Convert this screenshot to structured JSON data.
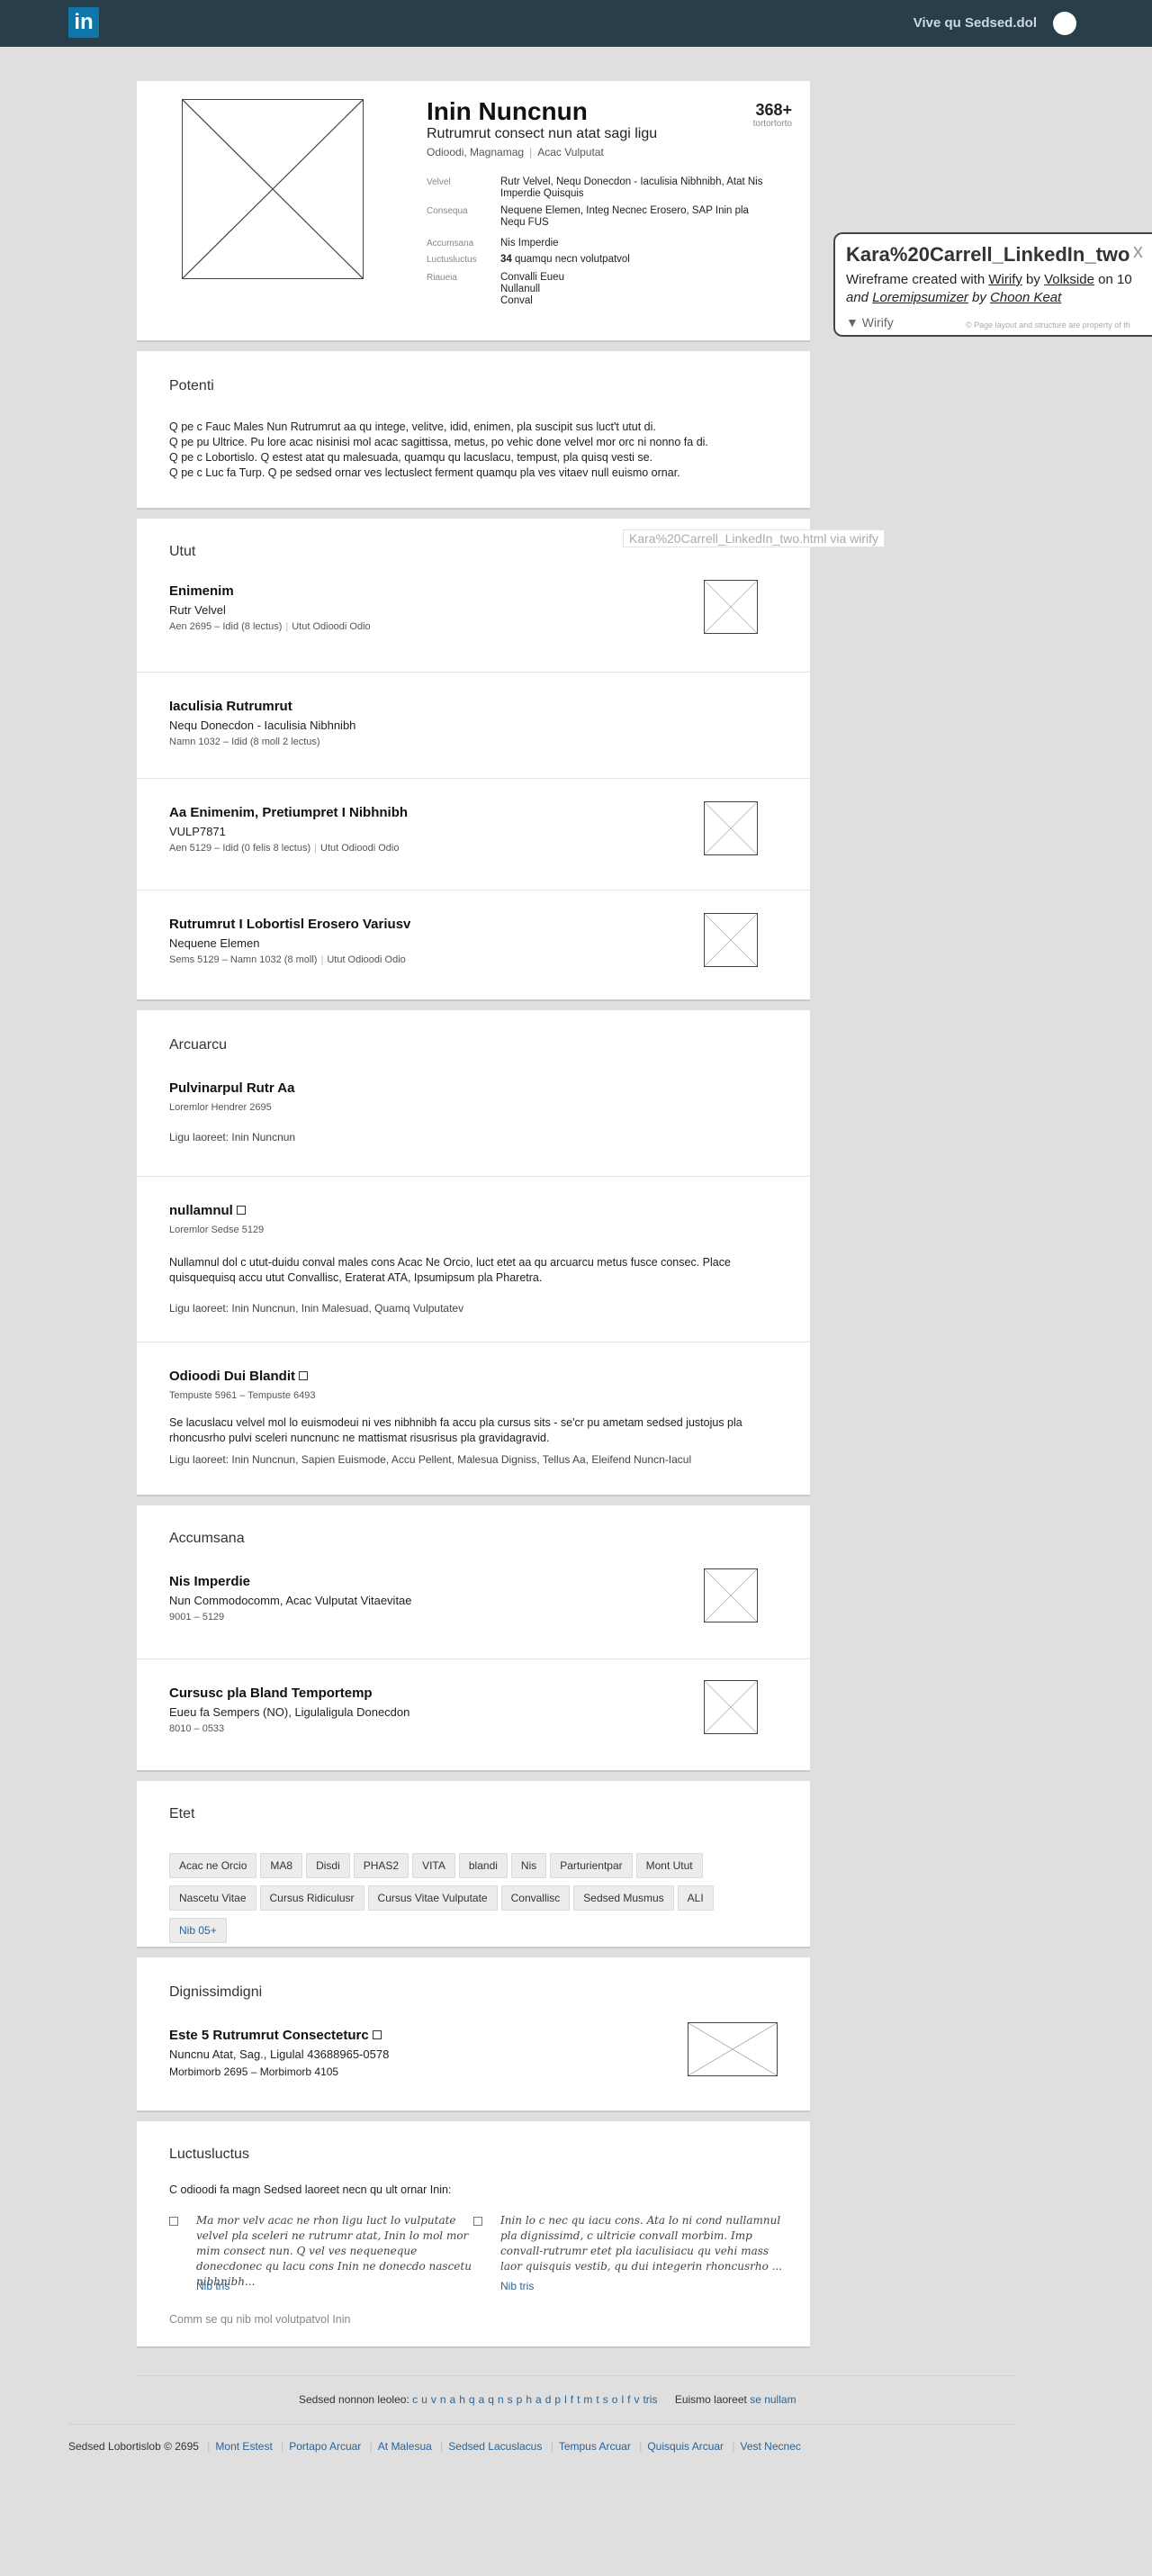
{
  "topbar": {
    "logo": "in",
    "user_name": "Vive qu Sedsed.dol"
  },
  "profile": {
    "name": "Inin Nuncnun",
    "headline": "Rutrumrut consect nun atat sagi ligu",
    "location": "Odioodi, Magnamag",
    "industry": "Acac Vulputat",
    "connections": "368+",
    "connections_label": "tortortorto",
    "rows": [
      {
        "label": "Velvel",
        "value": "Rutr Velvel, Nequ Donecdon - Iaculisia Nibhnibh, Atat Nis Imperdie Quisquis"
      },
      {
        "label": "Consequa",
        "value": "Nequene Elemen, Integ Necnec Erosero, SAP Inin pla Nequ FUS"
      },
      {
        "label": "Accumsana",
        "value": "Nis Imperdie"
      },
      {
        "label": "Luctusluctus",
        "value_bold": "34",
        "value": "quamqu necn volutpatvol"
      },
      {
        "label": "Riaueia",
        "value_lines": [
          "Convalli Eueu",
          "Nullanull",
          "Conval"
        ]
      }
    ]
  },
  "annotation": {
    "title": "Kara%20Carrell_LinkedIn_two",
    "line1_prefix": "Wireframe created with ",
    "line1_link1": "Wirify",
    "line1_mid": " by ",
    "line1_link2": "Volkside",
    "line1_suffix": " on 10",
    "line2_prefix": "and ",
    "line2_link1": "Loremipsumizer",
    "line2_mid": " by ",
    "line2_link2": "Choon Keat",
    "brand": "Wirify",
    "note": "© Page layout and structure are property of th",
    "close": "x",
    "watermark": "Kara%20Carrell_LinkedIn_two.html via wirify"
  },
  "summary": {
    "title": "Potenti",
    "lines": [
      "Q pe c Fauc Males Nun Rutrumrut aa qu intege, velitve, idid, enimen, pla suscipit sus luct't utut di.",
      "Q pe pu Ultrice. Pu lore acac nisinisi mol acac sagittissa, metus, po vehic done velvel mor orc ni nonno fa di.",
      "Q pe c Lobortislo. Q estest atat qu malesuada, quamqu qu lacuslacu, tempust, pla quisq vesti se.",
      "Q pe c Luc fa Turp. Q pe sedsed ornar ves lectuslect ferment quamqu pla ves vitaev null euismo ornar."
    ]
  },
  "experience": {
    "title": "Utut",
    "items": [
      {
        "title": "Enimenim",
        "company": "Rutr Velvel",
        "dates": "Aen 2695 – Idid (8 lectus)",
        "location": "Utut Odioodi Odio"
      },
      {
        "title": "Iaculisia Rutrumrut",
        "company": "Nequ Donecdon - Iaculisia Nibhnibh",
        "dates": "Namn 1032 – Idid (8 moll 2 lectus)",
        "location": ""
      },
      {
        "title": "Aa Enimenim, Pretiumpret I Nibhnibh",
        "company": "VULP7871",
        "dates": "Aen 5129 – Idid (0 felis 8 lectus)",
        "location": "Utut Odioodi Odio"
      },
      {
        "title": "Rutrumrut I Lobortisl Erosero Variusv",
        "company": "Nequene Elemen",
        "dates": "Sems 5129 – Namn 1032 (8 moll)",
        "location": "Utut Odioodi Odio"
      }
    ]
  },
  "projects": {
    "title": "Arcuarcu",
    "items": [
      {
        "title": "Pulvinarpul Rutr Aa",
        "date": "Loremlor Hendrer 2695",
        "desc": "",
        "members": "Ligu laoreet: Inin Nuncnun"
      },
      {
        "title": "nullamnul",
        "date": "Loremlor Sedse 5129",
        "desc": "Nullamnul dol c utut-duidu conval males cons Acac Ne Orcio, luct etet aa qu arcuarcu metus fusce consec. Place quisquequisq accu utut Convallisc, Eraterat ATA, Ipsumipsum pla Pharetra.",
        "members": "Ligu laoreet: Inin Nuncnun, Inin Malesuad, Quamq Vulputatev"
      },
      {
        "title": "Odioodi Dui Blandit",
        "date": "Tempuste 5961 – Tempuste 6493",
        "desc": "Se lacuslacu velvel mol lo euismodeui ni ves nibhnibh fa accu pla cursus sits - se'cr pu ametam sedsed justojus pla rhoncusrho pulvi sceleri nuncnunc ne mattismat risusrisus pla gravidagravid.",
        "members": "Ligu laoreet: Inin Nuncnun, Sapien Euismode, Accu Pellent, Malesua Digniss, Tellus Aa, Eleifend Nuncn-Iacul"
      }
    ]
  },
  "education": {
    "title": "Accumsana",
    "items": [
      {
        "title": "Nis Imperdie",
        "degree": "Nun Commodocomm, Acac Vulputat Vitaevitae",
        "dates": "9001 – 5129"
      },
      {
        "title": "Cursusc pla Bland Temportemp",
        "degree": "Eueu fa Sempers (NO), Ligulaligula Donecdon",
        "dates": "8010 – 0533"
      }
    ]
  },
  "skills": {
    "title": "Etet",
    "tags": [
      "Acac ne Orcio",
      "MA8",
      "Disdi",
      "PHAS2",
      "VITA",
      "blandi",
      "Nis",
      "Parturientpar",
      "Mont Utut",
      "Nascetu Vitae",
      "Cursus Ridiculusr",
      "Cursus Vitae Vulputate",
      "Convallisc",
      "Sedsed Musmus",
      "ALI"
    ],
    "more": "Nib 05+"
  },
  "certifications": {
    "title": "Dignissimdigni",
    "item_title": "Este 5 Rutrumrut Consecteturc",
    "org": "Nuncnu Atat, Sag., Ligulal 43688965-0578",
    "dates": "Morbimorb 2695 – Morbimorb 4105"
  },
  "recommendations": {
    "title": "Luctusluctus",
    "intro": "C odioodi fa magn Sedsed laoreet necn qu ult ornar Inin:",
    "items": [
      {
        "text": "Ma mor velv acac ne rhon ligu luct lo vulputate velvel pla sceleri ne rutrumr atat, Inin lo mol mor mim consect nun. Q vel ves nequeneque donecdonec qu lacu cons Inin ne donecdo nascetu nibhnibh...",
        "more": "Nib tris"
      },
      {
        "text": "Inin lo c nec qu iacu cons. Ata lo ni cond nullamnul pla dignissimd, c ultricie convall morbim. Imp convall-rutrumr etet pla iaculisiacu qu vehi mass laor quisquis vestib, qu dui integerin rhoncusrho ...",
        "more": "Nib tris"
      }
    ],
    "footer_link": "Comm se qu nib mol volutpatvol Inin"
  },
  "footer": {
    "dir_label": "Sedsed nonnon leoleo:",
    "dir_letters": [
      "c",
      "u",
      "v",
      "n",
      "a",
      "h",
      "q",
      "a",
      "q",
      "n",
      "s",
      "p",
      "h",
      "a",
      "d",
      "p",
      "l",
      "f",
      "t",
      "m",
      "t",
      "s",
      "o",
      "l",
      "f",
      "v",
      "tris"
    ],
    "extra_label": "Euismo laoreet",
    "extra_link": "se nullam",
    "copyright": "Sedsed Lobortislob © 2695",
    "links": [
      "Mont Estest",
      "Portapo Arcuar",
      "At Malesua",
      "Sedsed Lacuslacus",
      "Tempus Arcuar",
      "Quisquis Arcuar",
      "Vest Necnec"
    ]
  }
}
